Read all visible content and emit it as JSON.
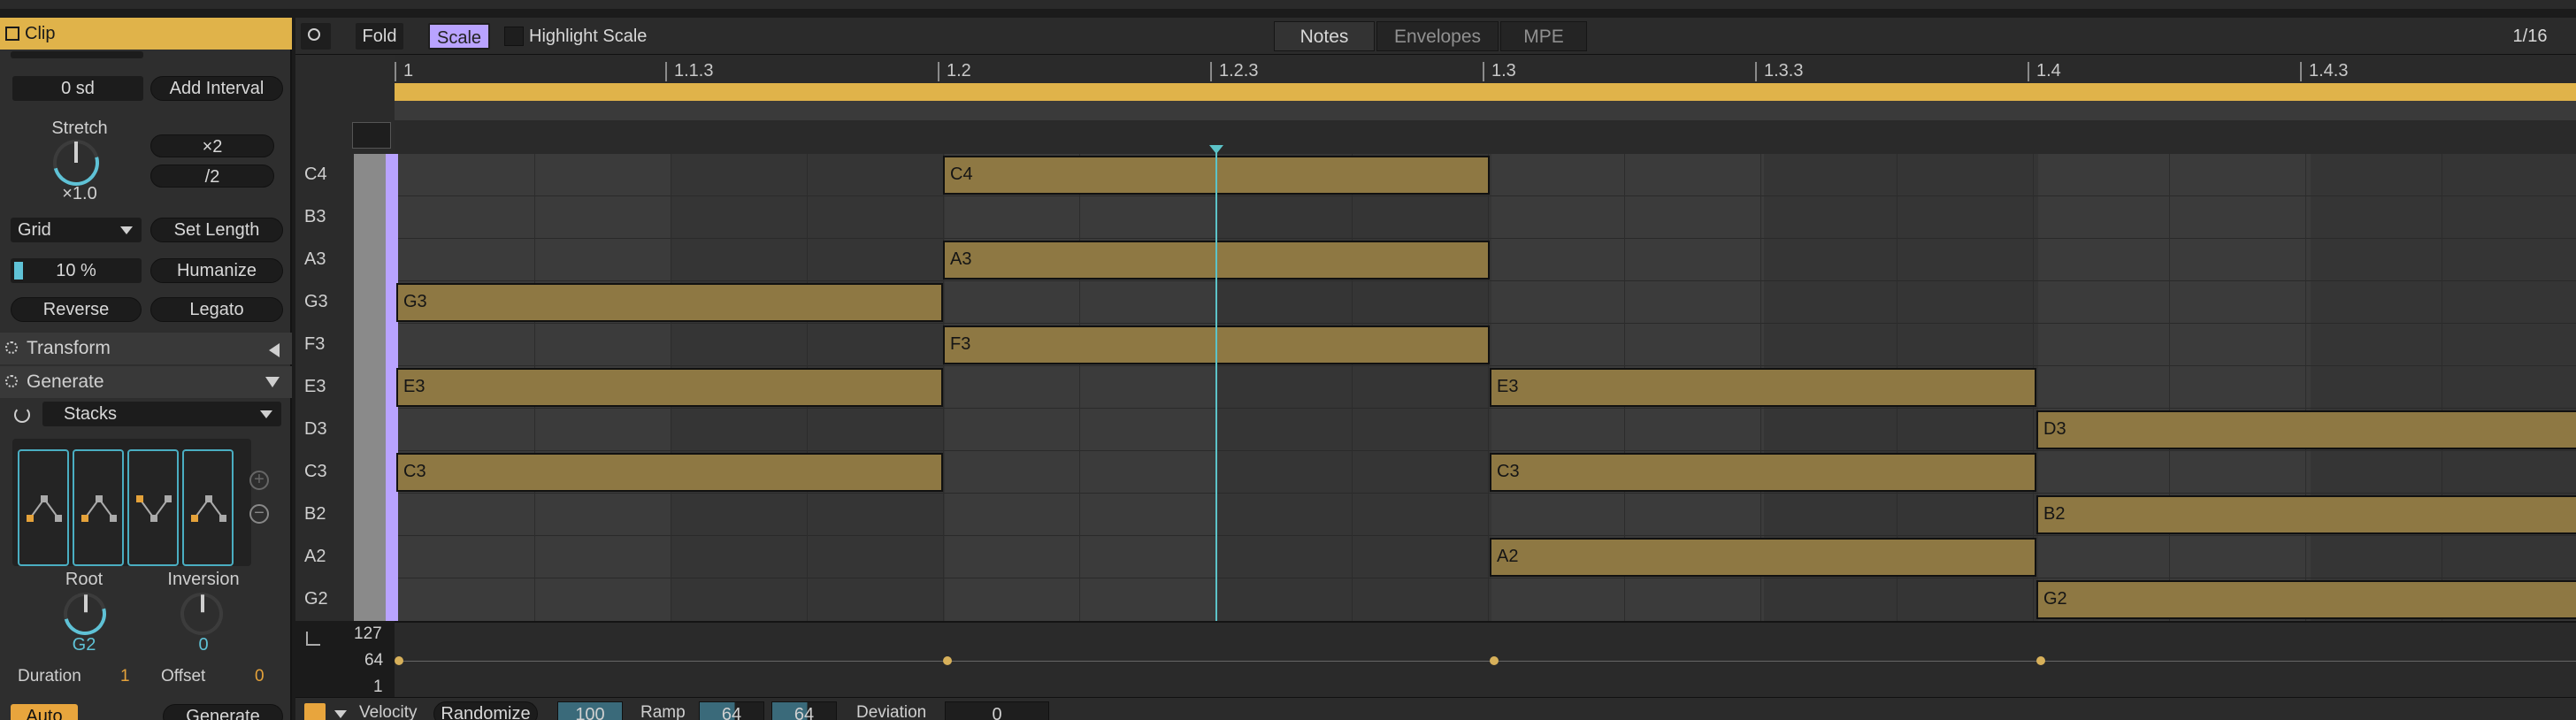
{
  "clip": {
    "title": "Clip"
  },
  "left": {
    "transpose_value": "0 sd",
    "add_interval": "Add Interval",
    "stretch_label": "Stretch",
    "stretch_value": "×1.0",
    "double": "×2",
    "half": "/2",
    "grid": "Grid",
    "set_length": "Set Length",
    "humanize_value": "10 %",
    "humanize": "Humanize",
    "reverse": "Reverse",
    "legato": "Legato",
    "transform": "Transform",
    "generate_section": "Generate",
    "generator": "Stacks",
    "root_label": "Root",
    "root_value": "G2",
    "inversion_label": "Inversion",
    "inversion_value": "0",
    "duration_label": "Duration",
    "duration_value": "1",
    "offset_label": "Offset",
    "offset_value": "0",
    "auto": "Auto",
    "generate_button": "Generate"
  },
  "toolbar": {
    "fold": "Fold",
    "scale": "Scale",
    "highlight_scale": "Highlight Scale",
    "tabs": [
      "Notes",
      "Envelopes",
      "MPE"
    ],
    "grid_value": "1/16"
  },
  "ruler": [
    "1",
    "1.1.3",
    "1.2",
    "1.2.3",
    "1.3",
    "1.3.3",
    "1.4",
    "1.4.3"
  ],
  "keys": [
    "C4",
    "B3",
    "A3",
    "G3",
    "F3",
    "E3",
    "D3",
    "C3",
    "B2",
    "A2",
    "G2"
  ],
  "notes": [
    {
      "pitch": "C4",
      "label": "C4"
    },
    {
      "pitch": "A3",
      "label": "A3"
    },
    {
      "pitch": "G3",
      "label": "G3"
    },
    {
      "pitch": "F3",
      "label": "F3"
    },
    {
      "pitch": "E3",
      "label": "E3"
    },
    {
      "pitch": "E3",
      "label": "E3"
    },
    {
      "pitch": "D3",
      "label": "D3"
    },
    {
      "pitch": "C3",
      "label": "C3"
    },
    {
      "pitch": "C3",
      "label": "C3"
    },
    {
      "pitch": "B2",
      "label": "B2"
    },
    {
      "pitch": "A2",
      "label": "A2"
    },
    {
      "pitch": "G2",
      "label": "G2"
    }
  ],
  "velocity_lane": {
    "max": "127",
    "mid": "64",
    "min": "1"
  },
  "bottom": {
    "velocity": "Velocity",
    "randomize": "Randomize",
    "randomize_value": "100",
    "ramp": "Ramp",
    "ramp_start": "64",
    "ramp_end": "64",
    "deviation": "Deviation",
    "deviation_value": "0"
  },
  "colors": {
    "accent": "#e0b34a",
    "note": "#8e7843",
    "playhead": "#5cc3c8",
    "scale": "#b9a3ff"
  }
}
